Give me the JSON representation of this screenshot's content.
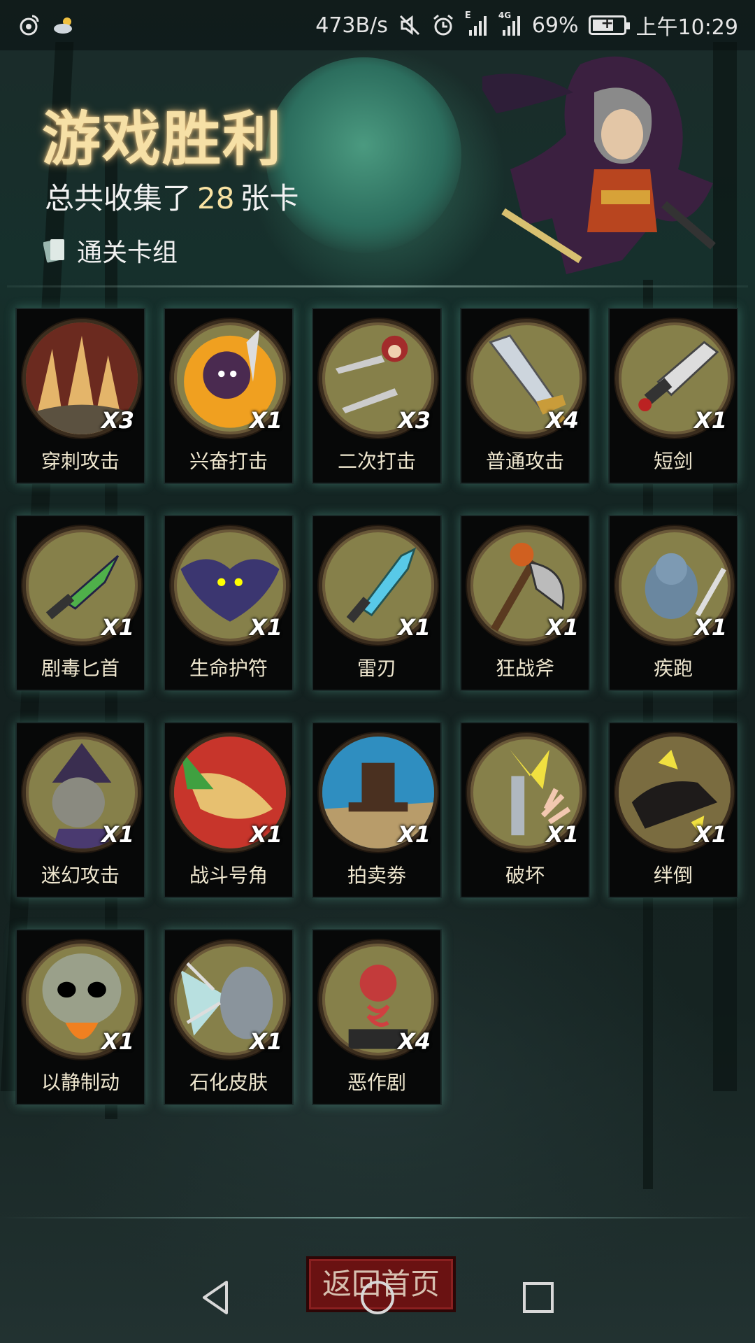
{
  "status_bar": {
    "net_speed": "473B/s",
    "battery_percent": "69%",
    "time": "上午10:29",
    "signal_1_label": "E",
    "signal_2_label": "4G",
    "battery_level": 0.69,
    "icons": [
      "weibo-icon",
      "weather-icon",
      "mute-icon",
      "alarm-icon",
      "signal-icon",
      "signal-4g-icon",
      "battery-icon"
    ]
  },
  "header": {
    "title": "游戏胜利",
    "subtitle_prefix": "总共收集了",
    "card_total": "28",
    "subtitle_suffix": "张卡",
    "deck_link": "通关卡组"
  },
  "cards": [
    {
      "name": "穿刺攻击",
      "count": "X3",
      "icon": "spikes-icon"
    },
    {
      "name": "兴奋打击",
      "count": "X1",
      "icon": "flame-hero-icon"
    },
    {
      "name": "二次打击",
      "count": "X3",
      "icon": "twin-daggers-icon"
    },
    {
      "name": "普通攻击",
      "count": "X4",
      "icon": "sword-icon"
    },
    {
      "name": "短剑",
      "count": "X1",
      "icon": "short-sword-icon"
    },
    {
      "name": "剧毒匕首",
      "count": "X1",
      "icon": "poison-dagger-icon"
    },
    {
      "name": "生命护符",
      "count": "X1",
      "icon": "bat-amulet-icon"
    },
    {
      "name": "雷刃",
      "count": "X1",
      "icon": "thunder-blade-icon"
    },
    {
      "name": "狂战斧",
      "count": "X1",
      "icon": "axe-icon"
    },
    {
      "name": "疾跑",
      "count": "X1",
      "icon": "wolf-runner-icon"
    },
    {
      "name": "迷幻攻击",
      "count": "X1",
      "icon": "witch-icon"
    },
    {
      "name": "战斗号角",
      "count": "X1",
      "icon": "war-horn-icon"
    },
    {
      "name": "拍卖劵",
      "count": "X1",
      "icon": "gavel-icon"
    },
    {
      "name": "破坏",
      "count": "X1",
      "icon": "break-icon"
    },
    {
      "name": "绊倒",
      "count": "X1",
      "icon": "boot-kick-icon"
    },
    {
      "name": "以静制动",
      "count": "X1",
      "icon": "skull-icon"
    },
    {
      "name": "石化皮肤",
      "count": "X1",
      "icon": "stone-skin-icon"
    },
    {
      "name": "恶作剧",
      "count": "X4",
      "icon": "jack-in-box-icon"
    }
  ],
  "footer": {
    "back_button": "返回首页"
  },
  "navbar": {
    "icons": [
      "back-nav-icon",
      "home-nav-icon",
      "recents-nav-icon"
    ]
  },
  "colors": {
    "title_gold": "#f6e0a6",
    "card_total_gold": "#f8e2a2",
    "medal_olive": "#86804a",
    "button_red": "#6a1212"
  }
}
